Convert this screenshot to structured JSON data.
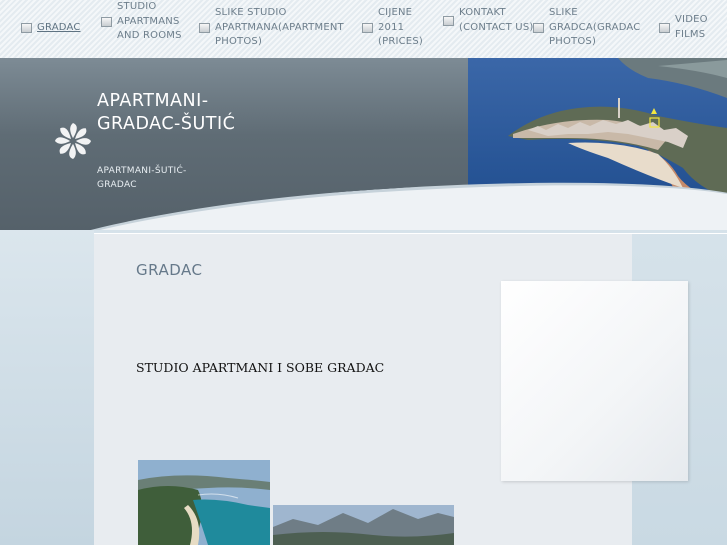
{
  "nav": {
    "items": [
      {
        "label": "GRADAC"
      },
      {
        "label": "STUDIO APARTMANS AND ROOMS"
      },
      {
        "label": "SLIKE STUDIO APARTMANA(APARTMENT PHOTOS)"
      },
      {
        "label": "CIJENE 2011 (PRICES)"
      },
      {
        "label": "KONTAKT (CONTACT US)"
      },
      {
        "label": "SLIKE GRADCA(GRADAC PHOTOS)"
      },
      {
        "label": "VIDEO FILMS"
      }
    ]
  },
  "header": {
    "title": "APARTMANI-GRADAC-ŠUTIĆ",
    "subtitle": "APARTMANI-ŠUTIĆ-GRADAC",
    "logo_icon": "pinwheel-logo-icon",
    "photo": "coastal-town-photo"
  },
  "content": {
    "page_title": "GRADAC",
    "heading": "STUDIO APARTMANI I SOBE GRADAC",
    "photos": [
      "beach-photo",
      "mountain-coast-photo"
    ]
  },
  "colors": {
    "header_bg": "#5f6c75",
    "nav_text": "#6d7e8b",
    "page_title": "#66798a",
    "content_bg": "#e8ecf0"
  }
}
